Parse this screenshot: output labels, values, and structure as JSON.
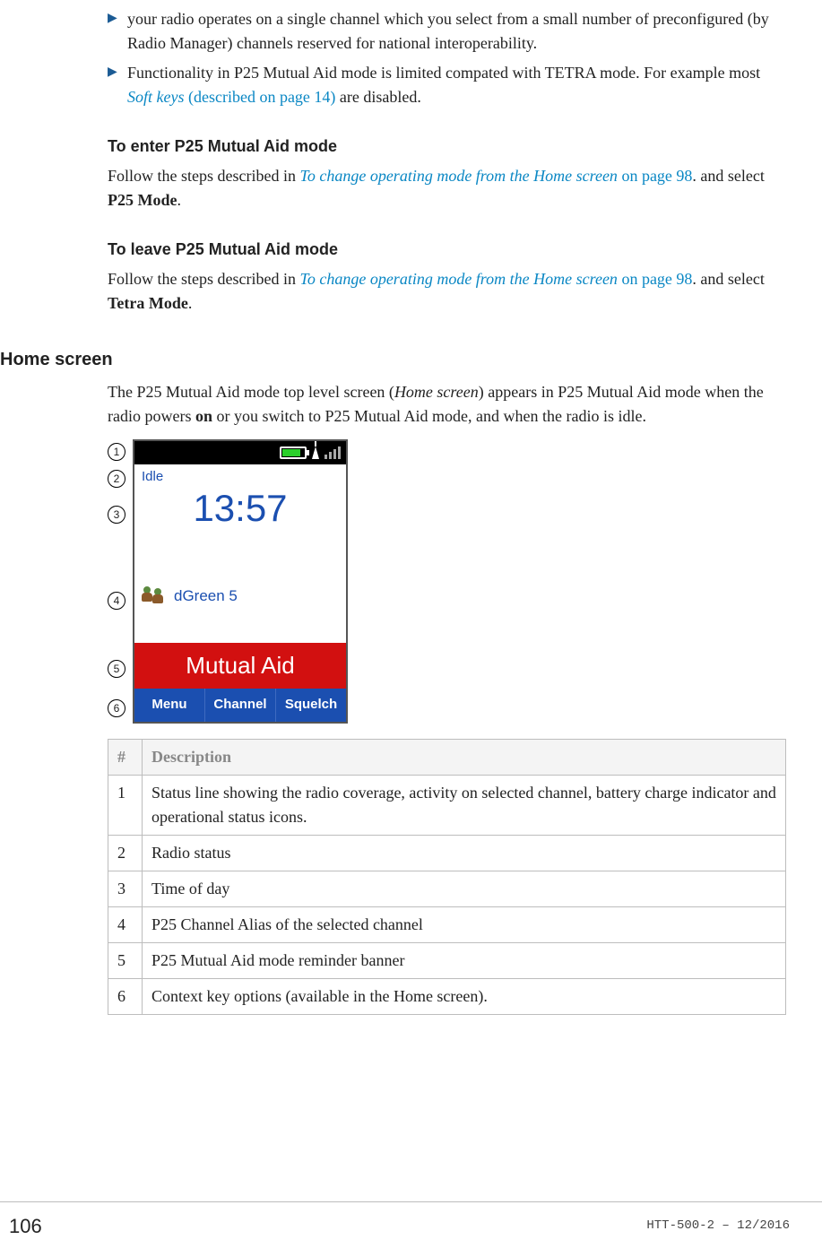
{
  "bullets": [
    {
      "text": "your radio operates on a single channel which you select from a small number of preconfigured (by Radio Manager) channels reserved for national interoperability."
    },
    {
      "text_pre": "Functionality in P25 Mutual Aid mode is limited compated with TETRA mode. For example most ",
      "link": "Soft keys",
      "link_page": " (described on page 14)",
      "text_post": " are disabled."
    }
  ],
  "enter": {
    "heading": "To enter P25 Mutual Aid mode",
    "para_pre": "Follow the steps described in ",
    "link": "To change operating mode from the Home screen",
    "link_page": " on page 98",
    "para_post_a": ". and select ",
    "bold": "P25 Mode",
    "para_post_b": "."
  },
  "leave": {
    "heading": "To leave P25 Mutual Aid mode",
    "para_pre": "Follow the steps described in ",
    "link": "To change operating mode from the Home screen",
    "link_page": " on page 98",
    "para_post_a": ". and select ",
    "bold": "Tetra Mode",
    "para_post_b": "."
  },
  "home": {
    "heading": "Home screen",
    "para_a": "The P25 Mutual Aid mode top level screen (",
    "italic": "Home screen",
    "para_b": ") appears in P25 Mutual Aid mode when the radio powers ",
    "bold": "on",
    "para_c": " or you switch to P25 Mutual Aid mode, and when the radio is idle."
  },
  "radio": {
    "idle": "Idle",
    "time": "13:57",
    "channel": "dGreen 5",
    "banner": "Mutual Aid",
    "softkeys": [
      "Menu",
      "Channel",
      "Squelch"
    ]
  },
  "callout_labels": [
    "1",
    "2",
    "3",
    "4",
    "5",
    "6"
  ],
  "table": {
    "h_num": "#",
    "h_desc": "Description",
    "rows": [
      {
        "n": "1",
        "d": "Status line showing the radio coverage, activity on selected channel, battery charge indicator and operational status icons."
      },
      {
        "n": "2",
        "d": "Radio status"
      },
      {
        "n": "3",
        "d": "Time of day"
      },
      {
        "n": "4",
        "d": "P25 Channel Alias of the selected channel"
      },
      {
        "n": "5",
        "d": "P25 Mutual Aid mode reminder banner"
      },
      {
        "n": "6",
        "d": "Context key options (available in the Home screen)."
      }
    ]
  },
  "footer": {
    "page": "106",
    "doc": "HTT-500-2 – 12/2016"
  }
}
